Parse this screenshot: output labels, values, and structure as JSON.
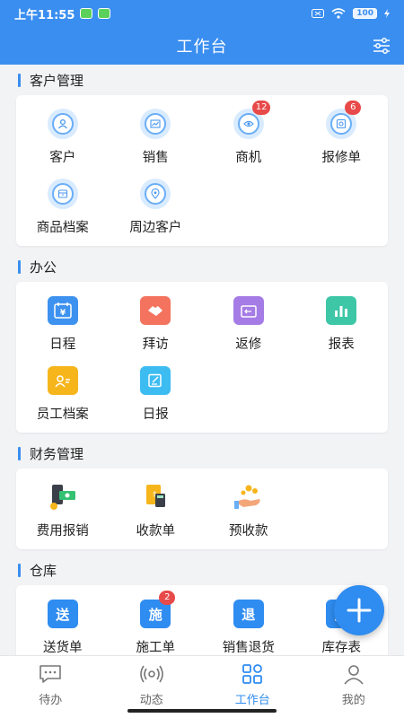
{
  "status": {
    "time": "上午11:55",
    "battery": "100"
  },
  "header": {
    "title": "工作台"
  },
  "sections": [
    {
      "title": "客户管理",
      "items": [
        {
          "label": "客户"
        },
        {
          "label": "销售"
        },
        {
          "label": "商机",
          "badge": "12"
        },
        {
          "label": "报修单",
          "badge": "6"
        },
        {
          "label": "商品档案"
        },
        {
          "label": "周边客户"
        }
      ]
    },
    {
      "title": "办公",
      "items": [
        {
          "label": "日程"
        },
        {
          "label": "拜访"
        },
        {
          "label": "返修"
        },
        {
          "label": "报表"
        },
        {
          "label": "员工档案"
        },
        {
          "label": "日报"
        }
      ]
    },
    {
      "title": "财务管理",
      "items": [
        {
          "label": "费用报销"
        },
        {
          "label": "收款单"
        },
        {
          "label": "预收款"
        }
      ]
    },
    {
      "title": "仓库",
      "items": [
        {
          "label": "送货单",
          "glyph": "送"
        },
        {
          "label": "施工单",
          "glyph": "施",
          "badge": "2"
        },
        {
          "label": "销售退货",
          "glyph": "退"
        },
        {
          "label": "库存表",
          "glyph": "库"
        }
      ]
    }
  ],
  "tabbar": [
    {
      "label": "待办",
      "icon": "chat-icon"
    },
    {
      "label": "动态",
      "icon": "broadcast-icon"
    },
    {
      "label": "工作台",
      "icon": "grid-icon",
      "active": true
    },
    {
      "label": "我的",
      "icon": "person-icon"
    }
  ],
  "colors": {
    "primary": "#3a8ef0",
    "badge": "#e84a4a"
  }
}
